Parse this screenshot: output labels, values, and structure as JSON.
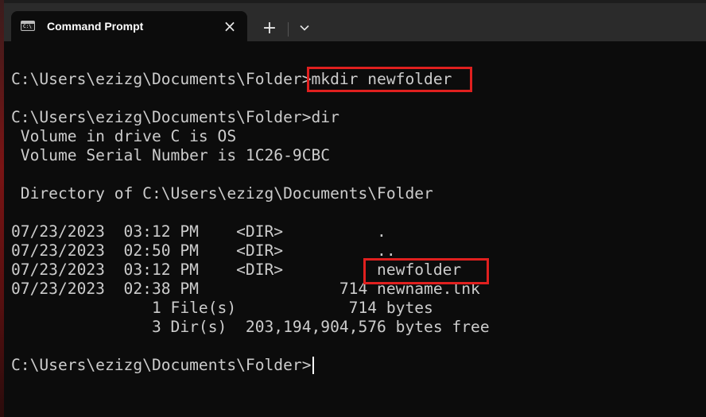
{
  "window": {
    "tab_title": "Command Prompt",
    "icons": {
      "tab_icon": "cmd-icon",
      "close": "close-icon",
      "new_tab": "plus-icon",
      "dropdown": "chevron-down-icon"
    },
    "tab_icon_glyph": "C:\\",
    "close_glyph": "×",
    "new_tab_glyph": "+"
  },
  "terminal": {
    "lines": [
      "",
      "C:\\Users\\ezizg\\Documents\\Folder>mkdir newfolder",
      "",
      "C:\\Users\\ezizg\\Documents\\Folder>dir",
      " Volume in drive C is OS",
      " Volume Serial Number is 1C26-9CBC",
      "",
      " Directory of C:\\Users\\ezizg\\Documents\\Folder",
      "",
      "07/23/2023  03:12 PM    <DIR>          .",
      "07/23/2023  02:50 PM    <DIR>          ..",
      "07/23/2023  03:12 PM    <DIR>          newfolder",
      "07/23/2023  02:38 PM               714 newname.lnk",
      "               1 File(s)            714 bytes",
      "               3 Dir(s)  203,194,904,576 bytes free",
      "",
      "C:\\Users\\ezizg\\Documents\\Folder>"
    ]
  },
  "colors": {
    "terminal_bg": "#0c0c0c",
    "terminal_fg": "#cccccc",
    "titlebar_bg": "#2b2b2b",
    "annotation_red": "#e0201f"
  }
}
